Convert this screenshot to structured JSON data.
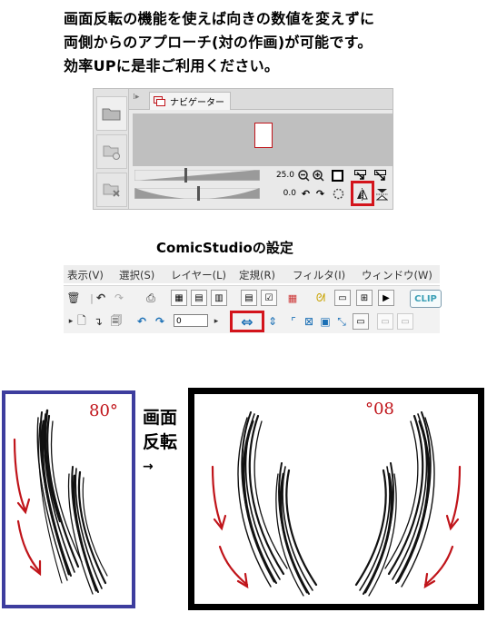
{
  "intro": {
    "line1": "画面反転の機能を使えば向きの数値を変えずに",
    "line2": "両側からのアプローチ(対の作画)が可能です。",
    "line3": "効率UPに是非ご利用ください。"
  },
  "navigator": {
    "tab_label": "ナビゲーター",
    "zoom_value": "25.0",
    "rotate_value": "0.0",
    "sidebar_icons": [
      "folder-icon",
      "layer-folder-icon",
      "layer-delete-icon"
    ],
    "zoom_slider_level": 0.4,
    "rotate_slider_level": 0.5,
    "highlight_color": "#d3141b"
  },
  "comicstudio": {
    "title": "ComicStudioの設定",
    "menu": [
      "表示(V)",
      "選択(S)",
      "レイヤー(L)",
      "定規(R)",
      "フィルタ(I)",
      "ウィンドウ(W)"
    ],
    "rotation_input": "0",
    "logo": "CLIP"
  },
  "illustration": {
    "left_angle": "80°",
    "right_angle": "80°",
    "middle_label_line1": "画面",
    "middle_label_line2": "反転",
    "middle_arrow": "→",
    "left_frame_color": "#3d3d9e",
    "right_frame_color": "#000000",
    "arrow_color": "#c0141a"
  }
}
